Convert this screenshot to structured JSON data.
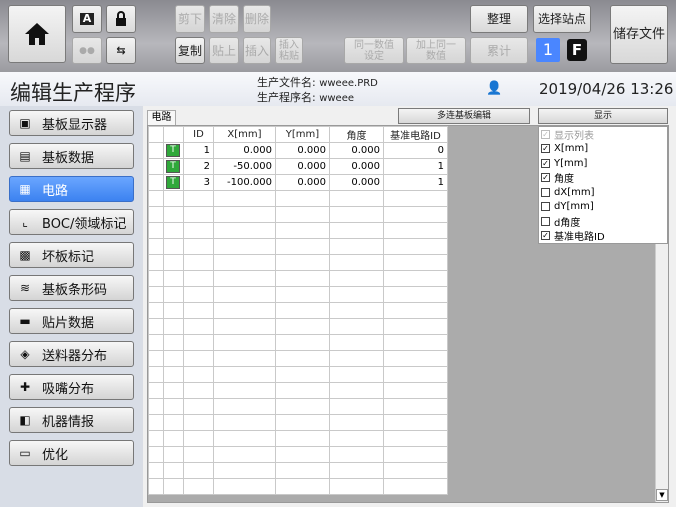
{
  "toolbar": {
    "cut": "剪下",
    "clear": "清除",
    "delete": "删除",
    "copy": "复制",
    "paste": "贴上",
    "insert": "插入",
    "insert_paste": "插入\n粘贴",
    "same_value": "同一数值\n设定",
    "add_same": "加上同一\n数值",
    "organize": "整理",
    "select_station": "选择站点",
    "accumulate": "累计",
    "station_number": "1",
    "station_letter": "F",
    "save_file": "储存文件"
  },
  "header": {
    "title": "编辑生产程序",
    "file_label": "生产文件名",
    "file_value": "wweee.PRD",
    "program_label": "生产程序名",
    "program_value": "wweee",
    "datetime": "2019/04/26 13:26"
  },
  "sidebar": {
    "items": [
      {
        "label": "基板显示器",
        "icon": "monitor-icon"
      },
      {
        "label": "基板数据",
        "icon": "board-data-icon"
      },
      {
        "label": "电路",
        "icon": "circuit-icon",
        "active": true
      },
      {
        "label": "BOC/领域标记",
        "icon": "boc-mark-icon"
      },
      {
        "label": "坏板标记",
        "icon": "bad-mark-icon"
      },
      {
        "label": "基板条形码",
        "icon": "barcode-icon"
      },
      {
        "label": "贴片数据",
        "icon": "mount-data-icon"
      },
      {
        "label": "送料器分布",
        "icon": "feeder-icon"
      },
      {
        "label": "吸嘴分布",
        "icon": "nozzle-icon"
      },
      {
        "label": "机器情报",
        "icon": "machine-info-icon"
      },
      {
        "label": "优化",
        "icon": "optimize-icon"
      }
    ]
  },
  "main": {
    "tab": "电路",
    "multi_board_button": "多连基板编辑",
    "display_button": "显示",
    "columns": [
      "",
      "",
      "ID",
      "X[mm]",
      "Y[mm]",
      "角度",
      "基准电路ID"
    ],
    "rows": [
      {
        "badge": "T",
        "id": "1",
        "x": "0.000",
        "y": "0.000",
        "angle": "0.000",
        "base": "0"
      },
      {
        "badge": "T",
        "id": "2",
        "x": "-50.000",
        "y": "0.000",
        "angle": "0.000",
        "base": "1"
      },
      {
        "badge": "T",
        "id": "3",
        "x": "-100.000",
        "y": "0.000",
        "angle": "0.000",
        "base": "1"
      }
    ],
    "display_options": [
      {
        "label": "显示列表",
        "checked": true,
        "disabled": true
      },
      {
        "label": "X[mm]",
        "checked": true
      },
      {
        "label": "Y[mm]",
        "checked": true
      },
      {
        "label": "角度",
        "checked": true
      },
      {
        "label": "dX[mm]",
        "checked": false
      },
      {
        "label": "dY[mm]",
        "checked": false
      },
      {
        "label": "d角度",
        "checked": false
      },
      {
        "label": "基准电路ID",
        "checked": true
      }
    ]
  },
  "colors": {
    "active": "#3c82f0",
    "badge": "#2fa83a"
  }
}
